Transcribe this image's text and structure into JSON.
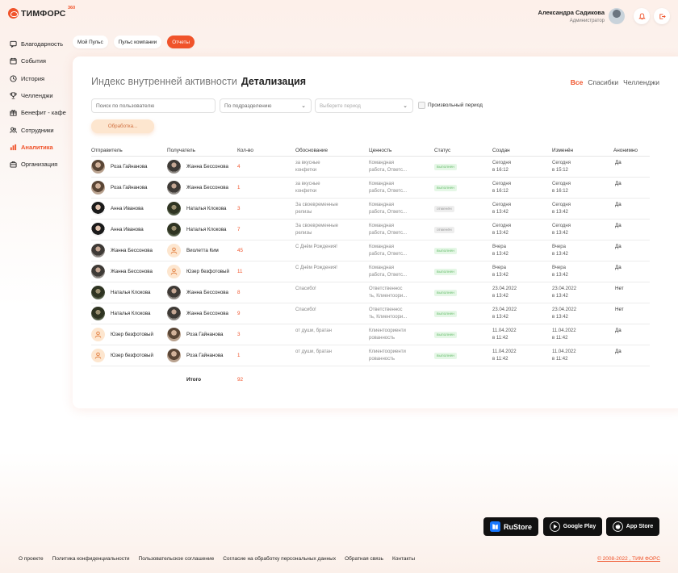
{
  "brand": {
    "name": "ТИМФОРС",
    "sup": "360",
    "accent": "#f0532a"
  },
  "user": {
    "name": "Александра Садикова",
    "role": "Администратор"
  },
  "sidebar": {
    "items": [
      {
        "label": "Благодарность",
        "icon": "message-icon"
      },
      {
        "label": "События",
        "icon": "calendar-icon"
      },
      {
        "label": "История",
        "icon": "clock-icon"
      },
      {
        "label": "Челленджи",
        "icon": "trophy-icon"
      },
      {
        "label": "Бенефит - кафе",
        "icon": "gift-icon"
      },
      {
        "label": "Сотрудники",
        "icon": "users-icon"
      },
      {
        "label": "Аналитика",
        "icon": "chart-icon",
        "active": true
      },
      {
        "label": "Организация",
        "icon": "briefcase-icon"
      }
    ]
  },
  "tabs": [
    {
      "label": "Мой Пульс"
    },
    {
      "label": "Пульс компании"
    },
    {
      "label": "Отчеты",
      "active": true
    }
  ],
  "card": {
    "title_main": "Индекс внутренней активности",
    "title_sub": "Детализация",
    "filters": [
      "Все",
      "Спасибки",
      "Челленджи"
    ],
    "search_placeholder": "Поиск по пользователю",
    "department": "По подразделению",
    "period_placeholder": "Выберите период",
    "custom_period": "Произвольный период",
    "processing": "Обработка..."
  },
  "table": {
    "columns": [
      "Отправитель",
      "Получатель",
      "Кол-во",
      "Обоснование",
      "Ценность",
      "Статус",
      "Создан",
      "Изменён",
      "Анонимно"
    ],
    "rows": [
      {
        "sender": "Роза Гайнанова",
        "sa": "rose",
        "recipient": "Жанна Бессонова",
        "ra": "zhanna",
        "qty": "4",
        "reason1": "за вкусные",
        "reason2": "конфетки",
        "value1": "Командная",
        "value2": "работа, Ответс...",
        "status": "выполнен",
        "st": "ok",
        "c1": "Сегодня",
        "c2": "в 16:12",
        "m1": "Сегодня",
        "m2": "в 15:12",
        "anon": "Да"
      },
      {
        "sender": "Роза Гайнанова",
        "sa": "rose",
        "recipient": "Жанна Бессонова",
        "ra": "zhanna",
        "qty": "1",
        "reason1": "за вкусные",
        "reason2": "конфетки",
        "value1": "Командная",
        "value2": "работа, Ответс...",
        "status": "выполнен",
        "st": "ok",
        "c1": "Сегодня",
        "c2": "в 16:12",
        "m1": "Сегодня",
        "m2": "в 16:12",
        "anon": "Да"
      },
      {
        "sender": "Анна Иванова",
        "sa": "anna",
        "recipient": "Наталья Клокова",
        "ra": "natalia",
        "qty": "3",
        "reason1": "За своевременные",
        "reason2": "релизы",
        "value1": "Командная",
        "value2": "работа, Ответс...",
        "status": "отменён",
        "st": "no",
        "c1": "Сегодня",
        "c2": "в 13:42",
        "m1": "Сегодня",
        "m2": "в 13:42",
        "anon": "Да"
      },
      {
        "sender": "Анна Иванова",
        "sa": "anna",
        "recipient": "Наталья Клокова",
        "ra": "natalia",
        "qty": "7",
        "reason1": "За своевременные",
        "reason2": "релизы",
        "value1": "Командная",
        "value2": "работа, Ответс...",
        "status": "отменён",
        "st": "no",
        "c1": "Сегодня",
        "c2": "в 13:42",
        "m1": "Сегодня",
        "m2": "в 13:42",
        "anon": "Да"
      },
      {
        "sender": "Жанна Бессонова",
        "sa": "zhanna",
        "recipient": "Виолетта Ким",
        "ra": "stub",
        "qty": "45",
        "reason1": "С Днём Рождения!",
        "reason2": "",
        "value1": "Командная",
        "value2": "работа, Ответс...",
        "status": "выполнен",
        "st": "ok",
        "c1": "Вчера",
        "c2": "в 13:42",
        "m1": "Вчера",
        "m2": "в 13:42",
        "anon": "Да"
      },
      {
        "sender": "Жанна Бессонова",
        "sa": "zhanna",
        "recipient": "Юзер безфотовый",
        "ra": "stub",
        "qty": "11",
        "reason1": "С Днём Рождения!",
        "reason2": "",
        "value1": "Командная",
        "value2": "работа, Ответс...",
        "status": "выполнен",
        "st": "ok",
        "c1": "Вчера",
        "c2": "в 13:42",
        "m1": "Вчера",
        "m2": "в 13:42",
        "anon": "Да"
      },
      {
        "sender": "Наталья Клокова",
        "sa": "natalia",
        "recipient": "Жанна Бессонова",
        "ra": "zhanna",
        "qty": "8",
        "reason1": "Спасибо!",
        "reason2": "",
        "value1": "Ответственнос",
        "value2": "ть, Клиентоори...",
        "status": "выполнен",
        "st": "ok",
        "c1": "23.04.2022",
        "c2": "в 13:42",
        "m1": "23.04.2022",
        "m2": "в 13:42",
        "anon": "Нет"
      },
      {
        "sender": "Наталья Клокова",
        "sa": "natalia",
        "recipient": "Жанна Бессонова",
        "ra": "zhanna",
        "qty": "9",
        "reason1": "Спасибо!",
        "reason2": "",
        "value1": "Ответственнос",
        "value2": "ть, Клиентоори...",
        "status": "выполнен",
        "st": "ok",
        "c1": "23.04.2022",
        "c2": "в 13:42",
        "m1": "23.04.2022",
        "m2": "в 13:42",
        "anon": "Нет"
      },
      {
        "sender": "Юзер безфотовый",
        "sa": "stub",
        "recipient": "Роза Гайнанова",
        "ra": "rose",
        "qty": "3",
        "reason1": "от души, братан",
        "reason2": "",
        "value1": "Клиентоориенти",
        "value2": "рованность",
        "status": "выполнен",
        "st": "ok",
        "c1": "11.04.2022",
        "c2": "в 11:42",
        "m1": "11.04.2022",
        "m2": "в 11:42",
        "anon": "Да"
      },
      {
        "sender": "Юзер безфотовый",
        "sa": "stub",
        "recipient": "Роза Гайнанова",
        "ra": "rose",
        "qty": "1",
        "reason1": "от души, братан",
        "reason2": "",
        "value1": "Клиентоориенти",
        "value2": "рованность",
        "status": "выполнен",
        "st": "ok",
        "c1": "11.04.2022",
        "c2": "в 11:42",
        "m1": "11.04.2022",
        "m2": "в 11:42",
        "anon": "Да"
      }
    ],
    "total_label": "Итого",
    "total_value": "92"
  },
  "stores": [
    {
      "label": "RuStore",
      "icon": "rustore-icon"
    },
    {
      "label": "Google Play",
      "icon": "google-play-icon"
    },
    {
      "label": "App Store",
      "icon": "apple-icon"
    }
  ],
  "footer": {
    "links": [
      "О проекте",
      "Политика конфиденциальности",
      "Пользовательское соглашение",
      "Согласие на обработку персональных данных",
      "Обратная связь",
      "Контакты"
    ],
    "copyright": "© 2008-2022 , ТИМ ФОРС"
  }
}
